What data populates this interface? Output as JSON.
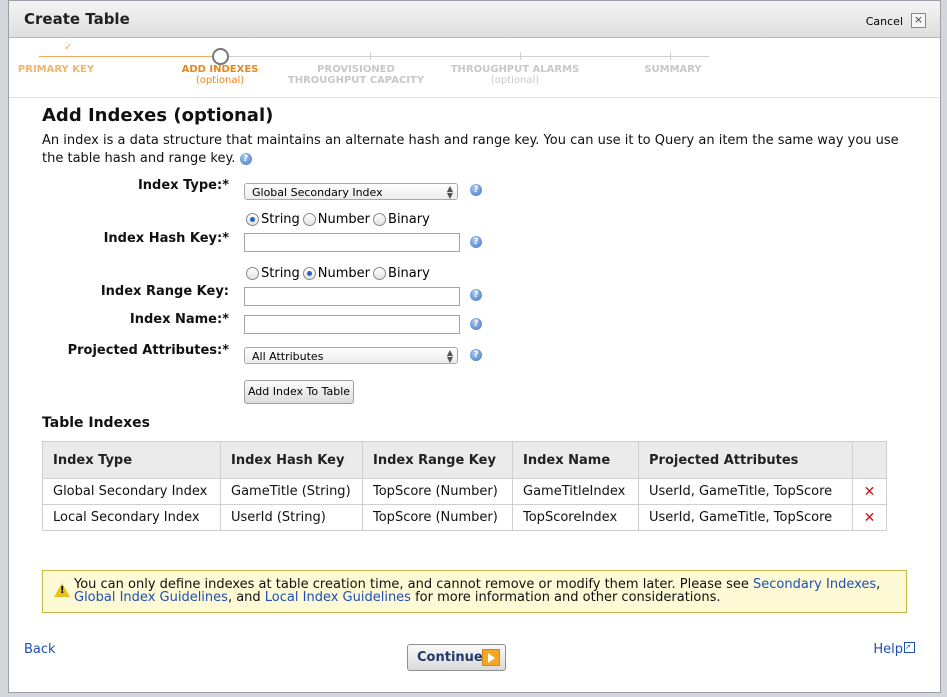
{
  "dialog": {
    "title": "Create Table",
    "cancel_label": "Cancel",
    "close_glyph": "×"
  },
  "wizard": {
    "steps": [
      {
        "label": "PRIMARY KEY",
        "sub": "",
        "state": "done"
      },
      {
        "label": "ADD INDEXES",
        "sub": "(optional)",
        "state": "current"
      },
      {
        "label": "PROVISIONED",
        "sub": "THROUGHPUT CAPACITY",
        "state": "todo"
      },
      {
        "label": "THROUGHPUT ALARMS",
        "sub": "(optional)",
        "state": "todo"
      },
      {
        "label": "SUMMARY",
        "sub": "",
        "state": "todo"
      }
    ],
    "done_check": "✓"
  },
  "section": {
    "title": "Add Indexes (optional)",
    "description": "An index is a data structure that maintains an alternate hash and range key. You can use it to Query an item the same way you use the table hash and range key."
  },
  "form": {
    "index_type": {
      "label": "Index Type:*",
      "value": "Global Secondary Index"
    },
    "hash_key": {
      "label": "Index Hash Key:*",
      "types": [
        "String",
        "Number",
        "Binary"
      ],
      "selected": "String",
      "value": ""
    },
    "range_key": {
      "label": "Index Range Key:",
      "types": [
        "String",
        "Number",
        "Binary"
      ],
      "selected": "Number",
      "value": ""
    },
    "index_name": {
      "label": "Index Name:*",
      "value": ""
    },
    "projected": {
      "label": "Projected Attributes:*",
      "value": "All Attributes"
    },
    "add_button": "Add Index To Table",
    "help_glyph": "?"
  },
  "indexes": {
    "title": "Table Indexes",
    "columns": [
      "Index Type",
      "Index Hash Key",
      "Index Range Key",
      "Index Name",
      "Projected Attributes"
    ],
    "rows": [
      [
        "Global Secondary Index",
        "GameTitle (String)",
        "TopScore (Number)",
        "GameTitleIndex",
        "UserId, GameTitle, TopScore"
      ],
      [
        "Local Secondary Index",
        "UserId (String)",
        "TopScore (Number)",
        "TopScoreIndex",
        "UserId, GameTitle, TopScore"
      ]
    ],
    "delete_glyph": "✕"
  },
  "warning": {
    "text_1": "You can only define indexes at table creation time, and cannot remove or modify them later. Please see ",
    "link_1": "Secondary Indexes",
    "text_2": ", ",
    "link_2": "Global Index Guidelines",
    "text_3": ", and ",
    "link_3": "Local Index Guidelines",
    "text_4": " for more information and other considerations."
  },
  "footer": {
    "back": "Back",
    "continue": "Continue",
    "help": "Help"
  },
  "colors": {
    "accent_orange": "#e8871e",
    "link_blue": "#1f4fb1",
    "delete_red": "#d2141b",
    "warning_bg": "#fdfad5"
  }
}
